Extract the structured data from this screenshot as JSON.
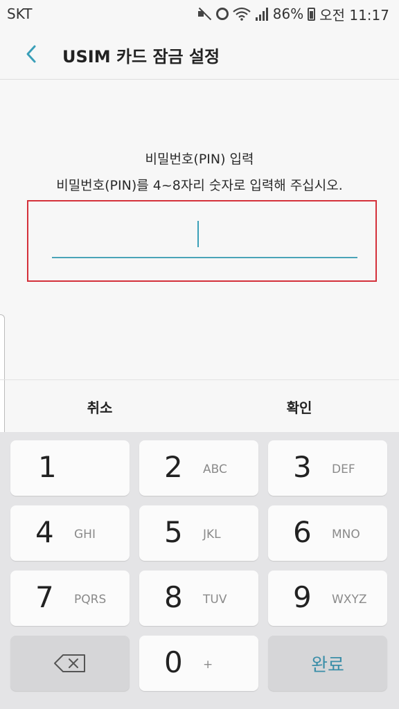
{
  "status_bar": {
    "carrier": "SKT",
    "battery": "86%",
    "time": "오전 11:17",
    "icons": [
      "mute-icon",
      "alarm-icon",
      "wifi-icon",
      "signal-icon",
      "battery-icon"
    ]
  },
  "app_bar": {
    "title": "USIM 카드 잠금 설정",
    "back_icon": "chevron-left-icon"
  },
  "prompt": {
    "title": "비밀번호(PIN) 입력",
    "description": "비밀번호(PIN)를 4~8자리 숫자로 입력해 주십시오.",
    "pin_value": ""
  },
  "dialog": {
    "cancel_label": "취소",
    "ok_label": "확인"
  },
  "keypad": {
    "keys": [
      {
        "digit": "1",
        "letters": ""
      },
      {
        "digit": "2",
        "letters": "ABC"
      },
      {
        "digit": "3",
        "letters": "DEF"
      },
      {
        "digit": "4",
        "letters": "GHI"
      },
      {
        "digit": "5",
        "letters": "JKL"
      },
      {
        "digit": "6",
        "letters": "MNO"
      },
      {
        "digit": "7",
        "letters": "PQRS"
      },
      {
        "digit": "8",
        "letters": "TUV"
      },
      {
        "digit": "9",
        "letters": "WXYZ"
      }
    ],
    "zero": {
      "digit": "0",
      "letters": "+"
    },
    "done_label": "완료"
  },
  "colors": {
    "accent": "#3b8ea8",
    "error_border": "#d4303a",
    "underline": "#4aa4b8"
  }
}
